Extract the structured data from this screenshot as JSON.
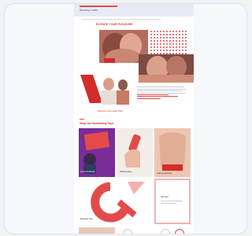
{
  "preheader": {
    "text": "Raunchy Lovers"
  },
  "banner": {
    "title": "ELEVATE YOUR PLEASURE"
  },
  "hero_caption": "Valentine's Day Deals 2024",
  "intro": {
    "lines": 7
  },
  "section_title": "Shop Our Bestselling Toys",
  "products": [
    {
      "label": "Lovers Kit Bundle",
      "art": "purple"
    },
    {
      "label": "Vibrating Ring",
      "art": "hand"
    },
    {
      "label": "Mens Underwear",
      "art": "torso"
    },
    {
      "label": "Bestseller Vibe",
      "art": "red-c"
    },
    {
      "label": "Gift Card",
      "art": "frame"
    }
  ],
  "colors": {
    "accent": "#e34b4b",
    "accent_dark": "#d42b2b",
    "purple": "#7a2c9a"
  }
}
